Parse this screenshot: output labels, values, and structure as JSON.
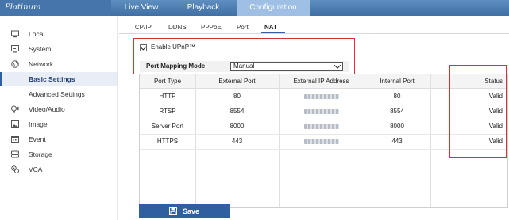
{
  "brand": "Platinum",
  "top_nav": [
    {
      "label": "Live View",
      "active": false
    },
    {
      "label": "Playback",
      "active": false
    },
    {
      "label": "Configuration",
      "active": true
    }
  ],
  "sidebar": {
    "items": [
      {
        "label": "Local",
        "icon": "monitor-icon"
      },
      {
        "label": "System",
        "icon": "system-icon"
      },
      {
        "label": "Network",
        "icon": "globe-icon"
      },
      {
        "label": "Basic Settings",
        "active": true
      },
      {
        "label": "Advanced Settings"
      },
      {
        "label": "Video/Audio",
        "icon": "video-audio-icon"
      },
      {
        "label": "Image",
        "icon": "image-icon"
      },
      {
        "label": "Event",
        "icon": "calendar-icon"
      },
      {
        "label": "Storage",
        "icon": "storage-icon"
      },
      {
        "label": "VCA",
        "icon": "vca-icon"
      }
    ]
  },
  "sub_tabs": [
    {
      "label": "TCP/IP"
    },
    {
      "label": "DDNS"
    },
    {
      "label": "PPPoE"
    },
    {
      "label": "Port"
    },
    {
      "label": "NAT",
      "active": true
    }
  ],
  "upnp": {
    "label": "Enable UPnP™",
    "checked": true
  },
  "port_mapping": {
    "label": "Port Mapping Mode",
    "value": "Manual"
  },
  "table": {
    "headers": [
      "Port Type",
      "External Port",
      "External IP Address",
      "Internal Port",
      "Status"
    ],
    "rows": [
      {
        "type": "HTTP",
        "external_port": "80",
        "internal_port": "80",
        "status": "Valid"
      },
      {
        "type": "RTSP",
        "external_port": "8554",
        "internal_port": "8554",
        "status": "Valid"
      },
      {
        "type": "Server Port",
        "external_port": "8000",
        "internal_port": "8000",
        "status": "Valid"
      },
      {
        "type": "HTTPS",
        "external_port": "443",
        "internal_port": "443",
        "status": "Valid"
      }
    ]
  },
  "save": {
    "label": "Save",
    "icon": "save-icon"
  },
  "colors": {
    "accent": "#2f5f9f",
    "highlight": "#d63232",
    "topbar": "#4575aa",
    "active_tab": "#9fc0e4"
  }
}
